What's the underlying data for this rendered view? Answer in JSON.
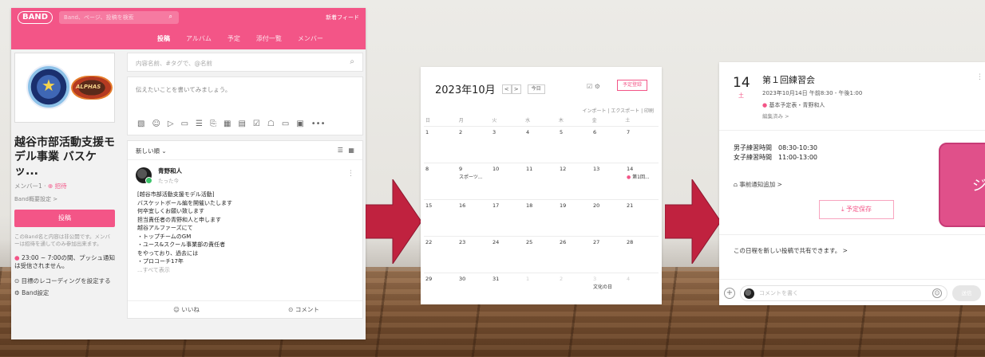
{
  "band": {
    "logo": "BAND",
    "search_placeholder": "Band、ページ、投稿を検索",
    "new_feed": "新着フィード",
    "tabs": [
      "投稿",
      "アルバム",
      "予定",
      "添付一覧",
      "メンバー"
    ],
    "group_name": "越谷市部活動支援モデル事業 バスケッ...",
    "members": "メンバー1 ·",
    "invite": "⊕ 招待",
    "band_settings_summary": "Band概要設定 >",
    "post_button": "投稿",
    "notice": "このBand名と内容は非公開です。メンバーは招待を通してのみ参加出来ます。",
    "push_notice": "23:00 ~ 7:00の間、プッシュ通知は受信されません。",
    "record_goal": "⊙ 目標のレコーディングを設定する",
    "band_settings": "⚙ Band設定",
    "search_posts_placeholder": "内容名前、#タグで、@名前",
    "composer_placeholder": "伝えたいことを書いてみましょう。",
    "sort_label": "新しい順 ⌄",
    "post": {
      "author": "青野和人",
      "time": "たった今",
      "lines": [
        "[越谷市部活動支援モデル活動]",
        "バスケットボール編を開催いたします",
        "何卒宜しくお願い致します",
        "担当責任者の青野和人と申します",
        "越谷アルファーズにて",
        "・トップチームのGM",
        "・ユース&スクール事業部の責任者",
        "をやっており、過去には",
        "・プロコーチ17年"
      ],
      "more": "...すべて表示",
      "like": "☺ いいね",
      "comment": "⊙ コメント"
    }
  },
  "calendar": {
    "title": "2023年10月",
    "prev": "<",
    "next": ">",
    "today": "今日",
    "icons": "☑  ⚙",
    "schedule_button": "予定登録",
    "links": "インポート | エクスポート | 印刷",
    "weekdays": [
      "日",
      "月",
      "火",
      "水",
      "木",
      "金",
      "土"
    ],
    "weeks": [
      [
        {
          "d": "1"
        },
        {
          "d": "2"
        },
        {
          "d": "3"
        },
        {
          "d": "4"
        },
        {
          "d": "5"
        },
        {
          "d": "6"
        },
        {
          "d": "7"
        }
      ],
      [
        {
          "d": "8"
        },
        {
          "d": "9",
          "ev": "スポーツ..."
        },
        {
          "d": "10"
        },
        {
          "d": "11"
        },
        {
          "d": "12"
        },
        {
          "d": "13"
        },
        {
          "d": "14",
          "ev": "第1回...",
          "dot": true
        }
      ],
      [
        {
          "d": "15"
        },
        {
          "d": "16"
        },
        {
          "d": "17"
        },
        {
          "d": "18"
        },
        {
          "d": "19"
        },
        {
          "d": "20"
        },
        {
          "d": "21"
        }
      ],
      [
        {
          "d": "22"
        },
        {
          "d": "23"
        },
        {
          "d": "24"
        },
        {
          "d": "25"
        },
        {
          "d": "26"
        },
        {
          "d": "27"
        },
        {
          "d": "28"
        }
      ],
      [
        {
          "d": "29"
        },
        {
          "d": "30"
        },
        {
          "d": "31"
        },
        {
          "d": "1",
          "f": true
        },
        {
          "d": "2",
          "f": true
        },
        {
          "d": "3",
          "f": true,
          "ev": "文化の日"
        },
        {
          "d": "4",
          "f": true
        }
      ]
    ]
  },
  "event": {
    "day": "14",
    "dow": "土",
    "title": "第１回練習会",
    "datetime": "2023年10月14日 午前8:30 - 午後1:00",
    "calendar": "基本予定表・青野和人",
    "edited": "編集済み >",
    "desc_lines": [
      "男子練習時間　08:30-10:30",
      "女子練習時間　11:00-13:00"
    ],
    "notify": "⩍ 事前通知追加 >",
    "save_button": "⤓ 予定保存",
    "share": "この日程を新しい投稿で共有できます。 >",
    "comment_placeholder": "コメントを書く",
    "send": "送信",
    "highlight_glyph": "ジ"
  },
  "colors": {
    "brand": "#f35587"
  }
}
